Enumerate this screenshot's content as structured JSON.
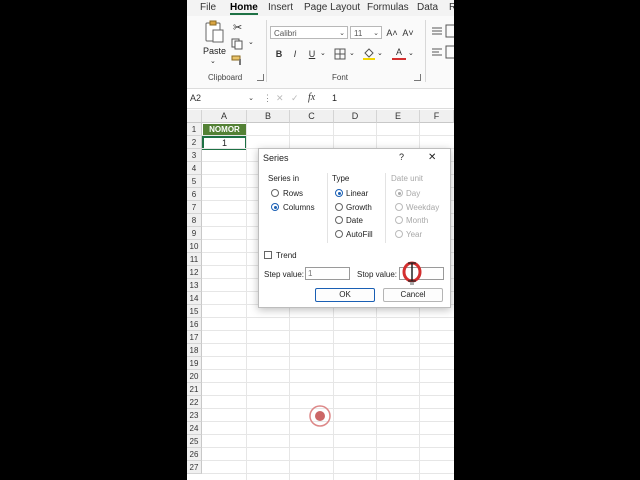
{
  "menu": {
    "tabs": [
      "File",
      "Home",
      "Insert",
      "Page Layout",
      "Formulas",
      "Data",
      "R"
    ],
    "active": "Home"
  },
  "ribbon": {
    "clipboard": {
      "paste_label": "Paste",
      "group_label": "Clipboard"
    },
    "font": {
      "font_name": "Calibri",
      "font_size": "11",
      "group_label": "Font",
      "bold": "B",
      "italic": "I",
      "underline": "U",
      "grow": "A˄",
      "shrink": "A˅",
      "font_color": "A"
    }
  },
  "formula_bar": {
    "name_box": "A2",
    "fx": "fx",
    "value": "1"
  },
  "sheet": {
    "columns": [
      "A",
      "B",
      "C",
      "D",
      "E",
      "F"
    ],
    "rows": [
      "1",
      "2",
      "3",
      "4",
      "5",
      "6",
      "7",
      "8",
      "9",
      "10",
      "11",
      "12",
      "13",
      "14",
      "15",
      "16",
      "17",
      "18",
      "19",
      "20",
      "21",
      "22",
      "23",
      "24",
      "25",
      "26",
      "27"
    ],
    "cells": {
      "A1": "NOMOR",
      "A2": "1"
    },
    "header_fill": "#538135"
  },
  "dialog": {
    "title": "Series",
    "help": "?",
    "close": "✕",
    "series_in": {
      "label": "Series in",
      "options": [
        "Rows",
        "Columns"
      ],
      "selected": "Columns"
    },
    "type": {
      "label": "Type",
      "options": [
        "Linear",
        "Growth",
        "Date",
        "AutoFill"
      ],
      "selected": "Linear"
    },
    "date_unit": {
      "label": "Date unit",
      "options": [
        "Day",
        "Weekday",
        "Month",
        "Year"
      ],
      "selected": "Day"
    },
    "trend_label": "Trend",
    "step_value_label": "Step value:",
    "step_value": "1",
    "stop_value_label": "Stop value:",
    "stop_value": "",
    "ok_label": "OK",
    "cancel_label": "Cancel"
  },
  "colors": {
    "accent": "#1e7145",
    "focus_blue": "#1a5fb4",
    "cursor_red": "#d32f2f"
  }
}
